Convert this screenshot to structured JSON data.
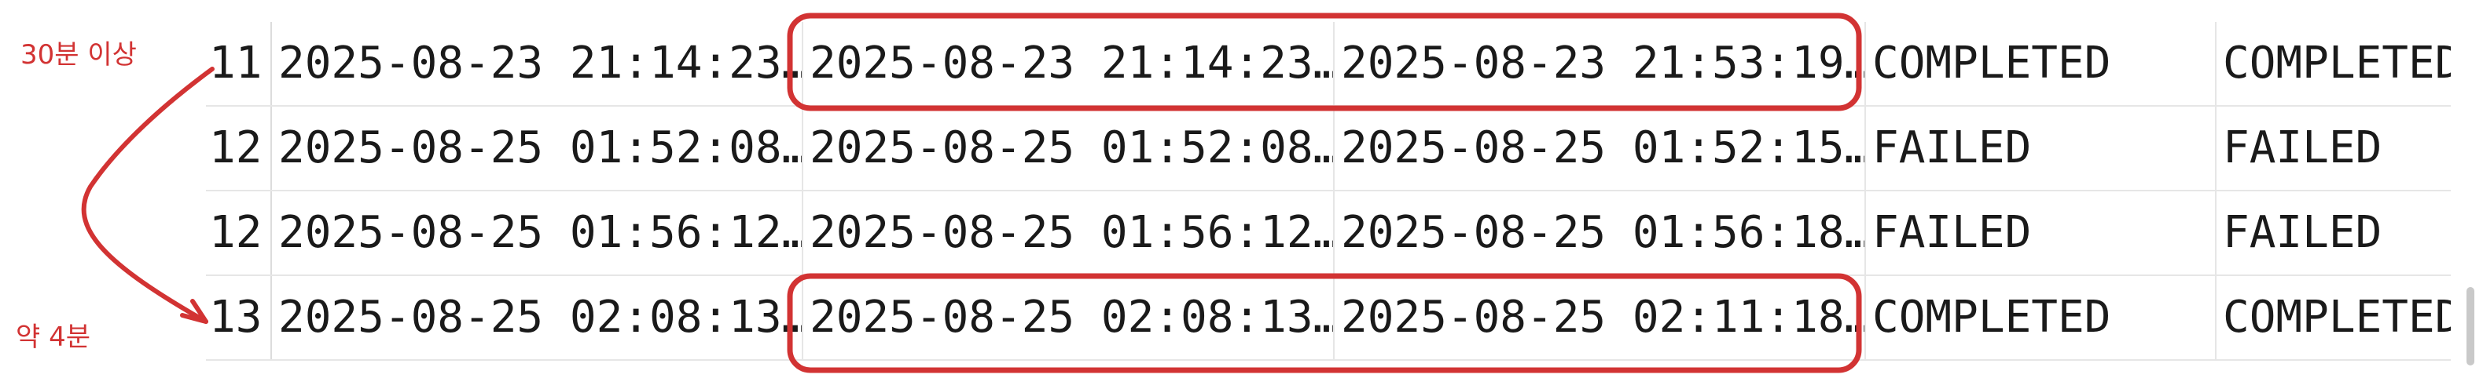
{
  "table": {
    "rows": [
      {
        "id": "11",
        "c1": "2025-08-23 21:14:23…",
        "c2": "2025-08-23 21:14:23…",
        "c3": "2025-08-23 21:53:19…",
        "status1": "COMPLETED",
        "status2": "COMPLETED"
      },
      {
        "id": "12",
        "c1": "2025-08-25 01:52:08…",
        "c2": "2025-08-25 01:52:08…",
        "c3": "2025-08-25 01:52:15…",
        "status1": "FAILED",
        "status2": "FAILED"
      },
      {
        "id": "12",
        "c1": "2025-08-25 01:56:12…",
        "c2": "2025-08-25 01:56:12…",
        "c3": "2025-08-25 01:56:18…",
        "status1": "FAILED",
        "status2": "FAILED"
      },
      {
        "id": "13",
        "c1": "2025-08-25 02:08:13…",
        "c2": "2025-08-25 02:08:13…",
        "c3": "2025-08-25 02:11:18…",
        "status1": "COMPLETED",
        "status2": "COMPLETED"
      }
    ]
  },
  "annotations": {
    "top_label": "30분 이상",
    "bottom_label": "약 4분",
    "color": "#d23333"
  }
}
